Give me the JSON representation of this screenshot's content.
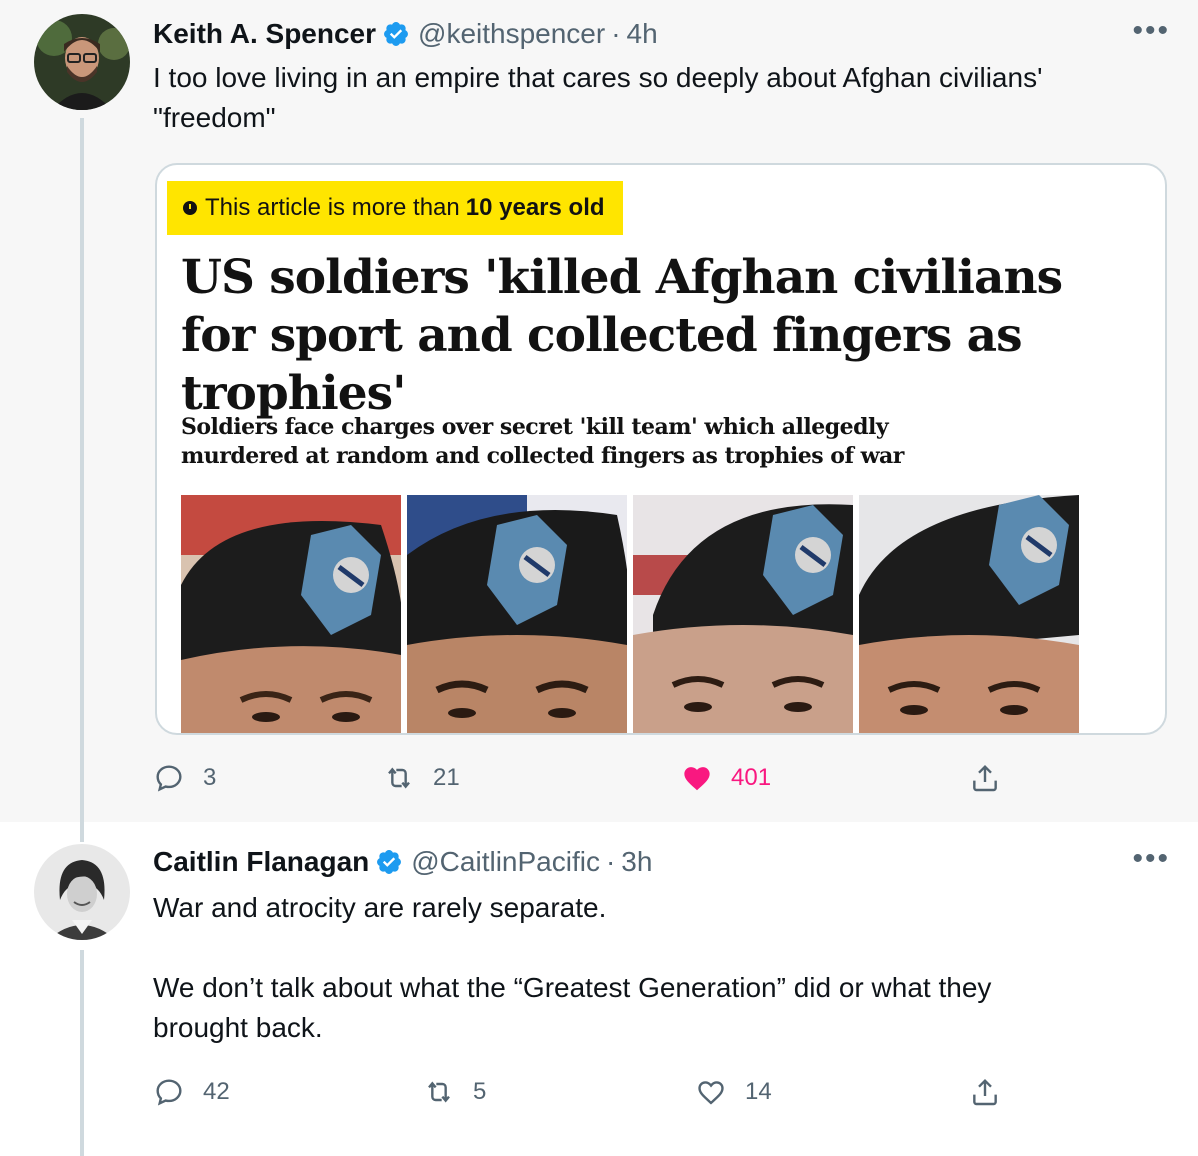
{
  "tweets": [
    {
      "name": "Keith A. Spencer",
      "handle": "@keithspencer",
      "separator": "·",
      "time": "4h",
      "text": "I too love living in an empire that cares so deeply about Afghan civilians'\n\"freedom\"",
      "card": {
        "banner_prefix": "This article is more than",
        "banner_bold": "10 years old",
        "headline": "US soldiers 'killed Afghan civilians for sport and collected fingers as trophies'",
        "standfirst": "Soldiers face charges over secret 'kill team' which allegedly murdered at random and collected fingers as trophies of war"
      },
      "replies": "3",
      "retweets": "21",
      "likes": "401",
      "liked": true
    },
    {
      "name": "Caitlin Flanagan",
      "handle": "@CaitlinPacific",
      "separator": "·",
      "time": "3h",
      "text": "War and atrocity are rarely separate.\n\nWe don’t talk about what the “Greatest Generation” did or what they\nbrought back.",
      "replies": "42",
      "retweets": "5",
      "likes": "14",
      "liked": false
    }
  ],
  "colors": {
    "verified": "#1d9bf0",
    "like_active": "#f91880",
    "banner": "#ffe500",
    "secondary_text": "#536471"
  },
  "icons": [
    "verified-badge-icon",
    "more-icon",
    "reply-icon",
    "retweet-icon",
    "like-icon",
    "share-icon",
    "clock-icon"
  ]
}
